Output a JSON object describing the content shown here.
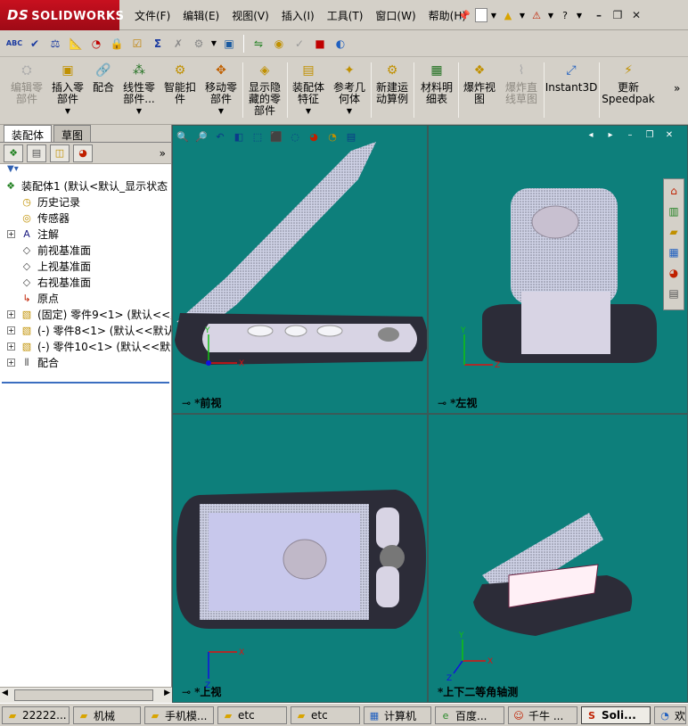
{
  "app": {
    "logo_prefix": "DS",
    "logo_name": "SOLIDWORKS"
  },
  "menu": [
    "文件(F)",
    "编辑(E)",
    "视图(V)",
    "插入(I)",
    "工具(T)",
    "窗口(W)",
    "帮助(H)"
  ],
  "title_icons": [
    "pin-icon",
    "new-document-icon",
    "open-icon",
    "warning-icon",
    "help-icon"
  ],
  "toolbar2_icons": [
    "spell-check-icon",
    "check-icon",
    "balance-icon",
    "measure-icon",
    "gauge-icon",
    "lock-icon",
    "checkbox-icon",
    "sum-icon",
    "cross-icon",
    "gear-icon",
    "screen-icon",
    "interference-icon",
    "hole-icon",
    "tick-circle-icon",
    "color-icon",
    "disc-icon"
  ],
  "command_manager": [
    {
      "label": "编辑零\n部件",
      "disabled": true,
      "arrow": false
    },
    {
      "label": "插入零\n部件",
      "disabled": false,
      "arrow": true
    },
    {
      "label": "配合",
      "disabled": false,
      "arrow": false
    },
    {
      "label": "线性零\n部件...",
      "disabled": false,
      "arrow": true
    },
    {
      "label": "智能扣\n件",
      "disabled": false,
      "arrow": false
    },
    {
      "label": "移动零\n部件",
      "disabled": false,
      "arrow": true
    },
    {
      "label": "显示隐\n藏的零\n部件",
      "disabled": false,
      "arrow": false
    },
    {
      "label": "装配体\n特征",
      "disabled": false,
      "arrow": true
    },
    {
      "label": "参考几\n何体",
      "disabled": false,
      "arrow": true
    },
    {
      "label": "新建运\n动算例",
      "disabled": false,
      "arrow": false
    },
    {
      "label": "材料明\n细表",
      "disabled": false,
      "arrow": false
    },
    {
      "label": "爆炸视\n图",
      "disabled": false,
      "arrow": false
    },
    {
      "label": "爆炸直\n线草图",
      "disabled": true,
      "arrow": false
    },
    {
      "label": "Instant3D",
      "disabled": false,
      "arrow": false
    },
    {
      "label": "更新\nSpeedpak",
      "disabled": false,
      "arrow": false
    }
  ],
  "left_tabs": [
    "装配体",
    "草图"
  ],
  "feature_tree": [
    {
      "label": "装配体1  (默认<默认_显示状态",
      "icon": "assembly-icon",
      "expander": "",
      "level": 0
    },
    {
      "label": "历史记录",
      "icon": "history-icon",
      "expander": "",
      "level": 1
    },
    {
      "label": "传感器",
      "icon": "sensor-icon",
      "expander": "",
      "level": 1
    },
    {
      "label": "注解",
      "icon": "annotation-icon",
      "expander": "+",
      "level": 1
    },
    {
      "label": "前视基准面",
      "icon": "plane-icon",
      "expander": "",
      "level": 1
    },
    {
      "label": "上视基准面",
      "icon": "plane-icon",
      "expander": "",
      "level": 1
    },
    {
      "label": "右视基准面",
      "icon": "plane-icon",
      "expander": "",
      "level": 1
    },
    {
      "label": "原点",
      "icon": "origin-icon",
      "expander": "",
      "level": 1
    },
    {
      "label": "(固定) 零件9<1> (默认<<默",
      "icon": "part-icon",
      "expander": "+",
      "level": 1
    },
    {
      "label": "(-) 零件8<1> (默认<<默认_",
      "icon": "part-icon",
      "expander": "+",
      "level": 1
    },
    {
      "label": "(-) 零件10<1> (默认<<默认",
      "icon": "part-icon",
      "expander": "+",
      "level": 1
    },
    {
      "label": "配合",
      "icon": "mates-icon",
      "expander": "+",
      "level": 1
    }
  ],
  "viewports": [
    {
      "label": "*前视"
    },
    {
      "label": "*左视"
    },
    {
      "label": "*上视"
    },
    {
      "label": "*上下二等角轴测"
    }
  ],
  "axes": {
    "x": "X",
    "y": "Y",
    "z": "Z"
  },
  "taskbar": [
    {
      "label": "22222...",
      "icon": "folder-icon",
      "active": false
    },
    {
      "label": "机械",
      "icon": "folder-icon",
      "active": false
    },
    {
      "label": "手机模...",
      "icon": "folder-icon",
      "active": false
    },
    {
      "label": "etc",
      "icon": "folder-icon",
      "active": false
    },
    {
      "label": "etc",
      "icon": "folder-icon",
      "active": false
    },
    {
      "label": "计算机",
      "icon": "computer-icon",
      "active": false
    },
    {
      "label": "百度...",
      "icon": "browser-icon",
      "active": false
    },
    {
      "label": "千牛 ...",
      "icon": "qianniu-icon",
      "active": false
    },
    {
      "label": "Soli...",
      "icon": "solidworks-icon",
      "active": true
    },
    {
      "label": "欢",
      "icon": "app-icon",
      "active": false
    }
  ]
}
